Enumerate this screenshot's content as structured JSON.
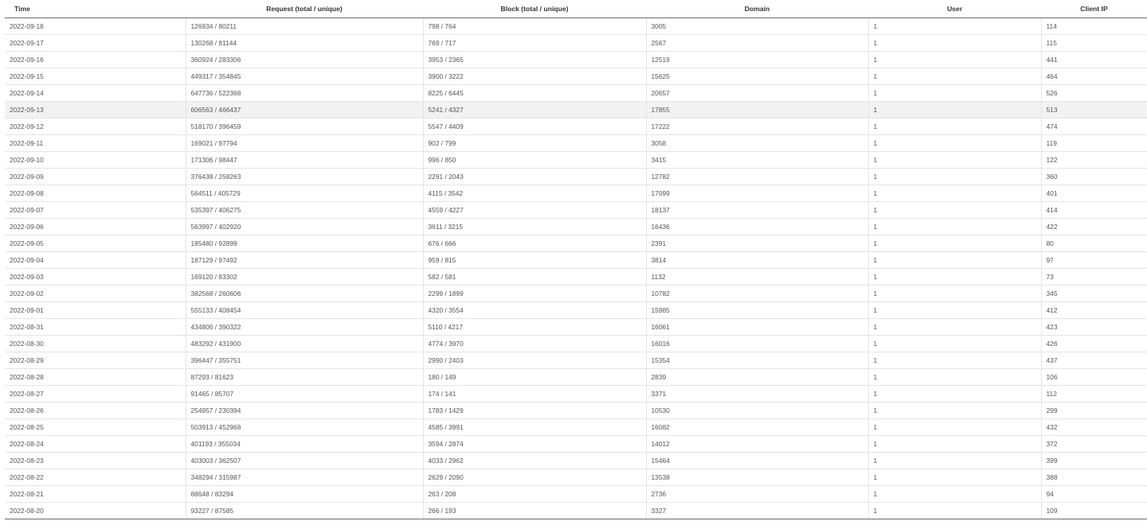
{
  "table": {
    "columns": [
      "Time",
      "Request (total / unique)",
      "Block (total / unique)",
      "Domain",
      "User",
      "Client IP"
    ],
    "highlighted_row": 5,
    "rows": [
      [
        "2022-09-18",
        "126934 / 80211",
        "798 / 764",
        "3005",
        "1",
        "114"
      ],
      [
        "2022-09-17",
        "130268 / 81144",
        "769 / 717",
        "2567",
        "1",
        "115"
      ],
      [
        "2022-09-16",
        "360924 / 283306",
        "3953 / 2365",
        "12519",
        "1",
        "441"
      ],
      [
        "2022-09-15",
        "449317 / 354845",
        "3900 / 3222",
        "15625",
        "1",
        "464"
      ],
      [
        "2022-09-14",
        "647736 / 522368",
        "8225 / 6445",
        "20657",
        "1",
        "526"
      ],
      [
        "2022-09-13",
        "606563 / 466437",
        "5241 / 4327",
        "17855",
        "1",
        "513"
      ],
      [
        "2022-09-12",
        "518170 / 396459",
        "5547 / 4409",
        "17222",
        "1",
        "474"
      ],
      [
        "2022-09-11",
        "169021 / 97794",
        "902 / 799",
        "3058",
        "1",
        "119"
      ],
      [
        "2022-09-10",
        "171306 / 98447",
        "996 / 850",
        "3415",
        "1",
        "122"
      ],
      [
        "2022-09-09",
        "376438 / 258263",
        "2291 / 2043",
        "12782",
        "1",
        "360"
      ],
      [
        "2022-09-08",
        "564511 / 405729",
        "4115 / 3542",
        "17099",
        "1",
        "401"
      ],
      [
        "2022-09-07",
        "535397 / 406275",
        "4559 / 4227",
        "18137",
        "1",
        "414"
      ],
      [
        "2022-09-06",
        "563997 / 402920",
        "3611 / 3215",
        "16436",
        "1",
        "422"
      ],
      [
        "2022-09-05",
        "185480 / 92899",
        "676 / 666",
        "2391",
        "1",
        "80"
      ],
      [
        "2022-09-04",
        "187129 / 97492",
        "959 / 815",
        "3814",
        "1",
        "97"
      ],
      [
        "2022-09-03",
        "169120 / 83302",
        "582 / 581",
        "1132",
        "1",
        "73"
      ],
      [
        "2022-09-02",
        "382568 / 260606",
        "2299 / 1899",
        "10782",
        "1",
        "345"
      ],
      [
        "2022-09-01",
        "555133 / 408454",
        "4320 / 3554",
        "15985",
        "1",
        "412"
      ],
      [
        "2022-08-31",
        "434806 / 390322",
        "5110 / 4217",
        "16061",
        "1",
        "423"
      ],
      [
        "2022-08-30",
        "483292 / 431900",
        "4774 / 3970",
        "16016",
        "1",
        "426"
      ],
      [
        "2022-08-29",
        "396447 / 355751",
        "2990 / 2403",
        "15354",
        "1",
        "437"
      ],
      [
        "2022-08-28",
        "87293 / 81623",
        "180 / 149",
        "2839",
        "1",
        "106"
      ],
      [
        "2022-08-27",
        "91465 / 85707",
        "174 / 141",
        "3371",
        "1",
        "112"
      ],
      [
        "2022-08-26",
        "254957 / 230394",
        "1783 / 1429",
        "10530",
        "1",
        "299"
      ],
      [
        "2022-08-25",
        "503913 / 452968",
        "4585 / 3991",
        "16082",
        "1",
        "432"
      ],
      [
        "2022-08-24",
        "401193 / 355034",
        "3594 / 2874",
        "14012",
        "1",
        "372"
      ],
      [
        "2022-08-23",
        "403003 / 362507",
        "4033 / 2962",
        "15464",
        "1",
        "399"
      ],
      [
        "2022-08-22",
        "348294 / 315987",
        "2629 / 2090",
        "13538",
        "1",
        "388"
      ],
      [
        "2022-08-21",
        "88648 / 83294",
        "263 / 208",
        "2736",
        "1",
        "94"
      ],
      [
        "2022-08-20",
        "93227 / 87585",
        "266 / 193",
        "3327",
        "1",
        "109"
      ]
    ]
  }
}
